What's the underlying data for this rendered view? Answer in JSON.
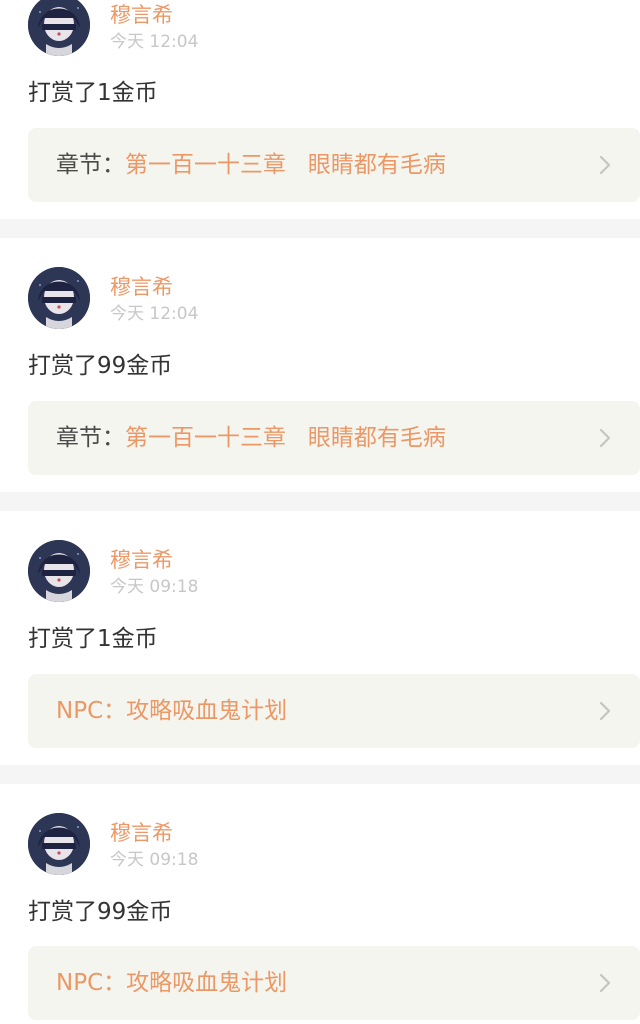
{
  "colors": {
    "accent": "#ec9866",
    "separator": "#f5f5f5",
    "link_box": "#f5f5ef",
    "time": "#c7c7c7",
    "text": "#333333"
  },
  "entries": [
    {
      "user": "穆言希",
      "time": "今天 12:04",
      "text": "打赏了1金币",
      "link_prefix": "章节：",
      "link_title": "第一百一十三章   眼睛都有毛病"
    },
    {
      "user": "穆言希",
      "time": "今天 12:04",
      "text": "打赏了99金币",
      "link_prefix": "章节：",
      "link_title": "第一百一十三章   眼睛都有毛病"
    },
    {
      "user": "穆言希",
      "time": "今天 09:18",
      "text": "打赏了1金币",
      "link_prefix": "NPC：",
      "link_title": "攻略吸血鬼计划"
    },
    {
      "user": "穆言希",
      "time": "今天 09:18",
      "text": "打赏了99金币",
      "link_prefix": "NPC：",
      "link_title": "攻略吸血鬼计划"
    }
  ]
}
